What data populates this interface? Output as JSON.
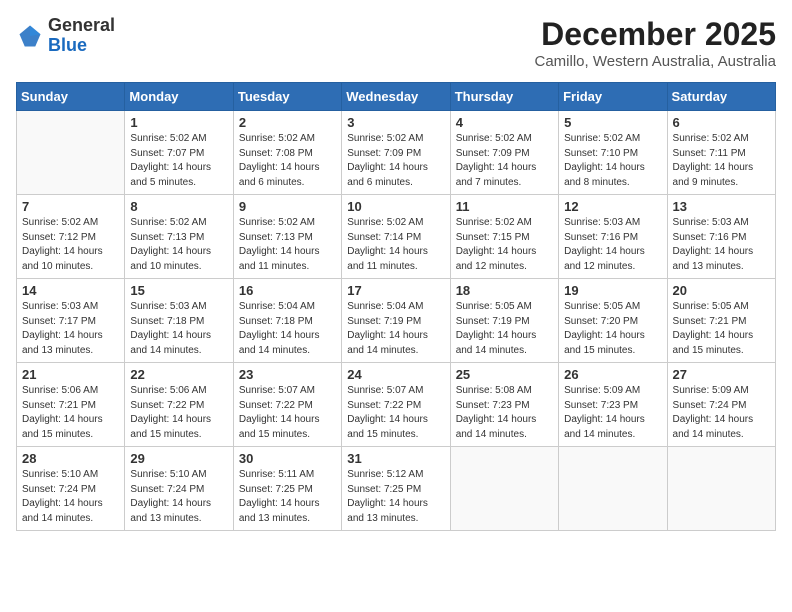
{
  "header": {
    "logo_general": "General",
    "logo_blue": "Blue",
    "title": "December 2025",
    "subtitle": "Camillo, Western Australia, Australia"
  },
  "calendar": {
    "headers": [
      "Sunday",
      "Monday",
      "Tuesday",
      "Wednesday",
      "Thursday",
      "Friday",
      "Saturday"
    ],
    "weeks": [
      [
        {
          "day": "",
          "info": ""
        },
        {
          "day": "1",
          "info": "Sunrise: 5:02 AM\nSunset: 7:07 PM\nDaylight: 14 hours\nand 5 minutes."
        },
        {
          "day": "2",
          "info": "Sunrise: 5:02 AM\nSunset: 7:08 PM\nDaylight: 14 hours\nand 6 minutes."
        },
        {
          "day": "3",
          "info": "Sunrise: 5:02 AM\nSunset: 7:09 PM\nDaylight: 14 hours\nand 6 minutes."
        },
        {
          "day": "4",
          "info": "Sunrise: 5:02 AM\nSunset: 7:09 PM\nDaylight: 14 hours\nand 7 minutes."
        },
        {
          "day": "5",
          "info": "Sunrise: 5:02 AM\nSunset: 7:10 PM\nDaylight: 14 hours\nand 8 minutes."
        },
        {
          "day": "6",
          "info": "Sunrise: 5:02 AM\nSunset: 7:11 PM\nDaylight: 14 hours\nand 9 minutes."
        }
      ],
      [
        {
          "day": "7",
          "info": "Sunrise: 5:02 AM\nSunset: 7:12 PM\nDaylight: 14 hours\nand 10 minutes."
        },
        {
          "day": "8",
          "info": "Sunrise: 5:02 AM\nSunset: 7:13 PM\nDaylight: 14 hours\nand 10 minutes."
        },
        {
          "day": "9",
          "info": "Sunrise: 5:02 AM\nSunset: 7:13 PM\nDaylight: 14 hours\nand 11 minutes."
        },
        {
          "day": "10",
          "info": "Sunrise: 5:02 AM\nSunset: 7:14 PM\nDaylight: 14 hours\nand 11 minutes."
        },
        {
          "day": "11",
          "info": "Sunrise: 5:02 AM\nSunset: 7:15 PM\nDaylight: 14 hours\nand 12 minutes."
        },
        {
          "day": "12",
          "info": "Sunrise: 5:03 AM\nSunset: 7:16 PM\nDaylight: 14 hours\nand 12 minutes."
        },
        {
          "day": "13",
          "info": "Sunrise: 5:03 AM\nSunset: 7:16 PM\nDaylight: 14 hours\nand 13 minutes."
        }
      ],
      [
        {
          "day": "14",
          "info": "Sunrise: 5:03 AM\nSunset: 7:17 PM\nDaylight: 14 hours\nand 13 minutes."
        },
        {
          "day": "15",
          "info": "Sunrise: 5:03 AM\nSunset: 7:18 PM\nDaylight: 14 hours\nand 14 minutes."
        },
        {
          "day": "16",
          "info": "Sunrise: 5:04 AM\nSunset: 7:18 PM\nDaylight: 14 hours\nand 14 minutes."
        },
        {
          "day": "17",
          "info": "Sunrise: 5:04 AM\nSunset: 7:19 PM\nDaylight: 14 hours\nand 14 minutes."
        },
        {
          "day": "18",
          "info": "Sunrise: 5:05 AM\nSunset: 7:19 PM\nDaylight: 14 hours\nand 14 minutes."
        },
        {
          "day": "19",
          "info": "Sunrise: 5:05 AM\nSunset: 7:20 PM\nDaylight: 14 hours\nand 15 minutes."
        },
        {
          "day": "20",
          "info": "Sunrise: 5:05 AM\nSunset: 7:21 PM\nDaylight: 14 hours\nand 15 minutes."
        }
      ],
      [
        {
          "day": "21",
          "info": "Sunrise: 5:06 AM\nSunset: 7:21 PM\nDaylight: 14 hours\nand 15 minutes."
        },
        {
          "day": "22",
          "info": "Sunrise: 5:06 AM\nSunset: 7:22 PM\nDaylight: 14 hours\nand 15 minutes."
        },
        {
          "day": "23",
          "info": "Sunrise: 5:07 AM\nSunset: 7:22 PM\nDaylight: 14 hours\nand 15 minutes."
        },
        {
          "day": "24",
          "info": "Sunrise: 5:07 AM\nSunset: 7:22 PM\nDaylight: 14 hours\nand 15 minutes."
        },
        {
          "day": "25",
          "info": "Sunrise: 5:08 AM\nSunset: 7:23 PM\nDaylight: 14 hours\nand 14 minutes."
        },
        {
          "day": "26",
          "info": "Sunrise: 5:09 AM\nSunset: 7:23 PM\nDaylight: 14 hours\nand 14 minutes."
        },
        {
          "day": "27",
          "info": "Sunrise: 5:09 AM\nSunset: 7:24 PM\nDaylight: 14 hours\nand 14 minutes."
        }
      ],
      [
        {
          "day": "28",
          "info": "Sunrise: 5:10 AM\nSunset: 7:24 PM\nDaylight: 14 hours\nand 14 minutes."
        },
        {
          "day": "29",
          "info": "Sunrise: 5:10 AM\nSunset: 7:24 PM\nDaylight: 14 hours\nand 13 minutes."
        },
        {
          "day": "30",
          "info": "Sunrise: 5:11 AM\nSunset: 7:25 PM\nDaylight: 14 hours\nand 13 minutes."
        },
        {
          "day": "31",
          "info": "Sunrise: 5:12 AM\nSunset: 7:25 PM\nDaylight: 14 hours\nand 13 minutes."
        },
        {
          "day": "",
          "info": ""
        },
        {
          "day": "",
          "info": ""
        },
        {
          "day": "",
          "info": ""
        }
      ]
    ]
  }
}
